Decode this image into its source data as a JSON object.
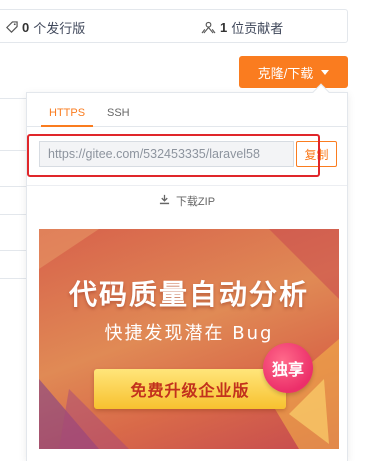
{
  "stats": {
    "releases": {
      "count": "0",
      "label": "个发行版",
      "icon": "tag-icon"
    },
    "contributors": {
      "count": "1",
      "label": "位贡献者",
      "icon": "people-icon"
    }
  },
  "clone_button": {
    "label": "克隆/下载",
    "color": "#fa7c1f"
  },
  "panel": {
    "tabs": [
      {
        "label": "HTTPS",
        "active": true
      },
      {
        "label": "SSH",
        "active": false
      }
    ],
    "url": {
      "value": "https://gitee.com/532453335/laravel58"
    },
    "copy_label": "复制",
    "download_zip_label": "下载ZIP"
  },
  "banner": {
    "title": "代码质量自动分析",
    "subtitle": "快捷发现潜在 Bug",
    "button_label": "免费升级企业版",
    "badge": "独享"
  },
  "colors": {
    "accent": "#fa7c1f",
    "highlight": "#e0262a"
  }
}
